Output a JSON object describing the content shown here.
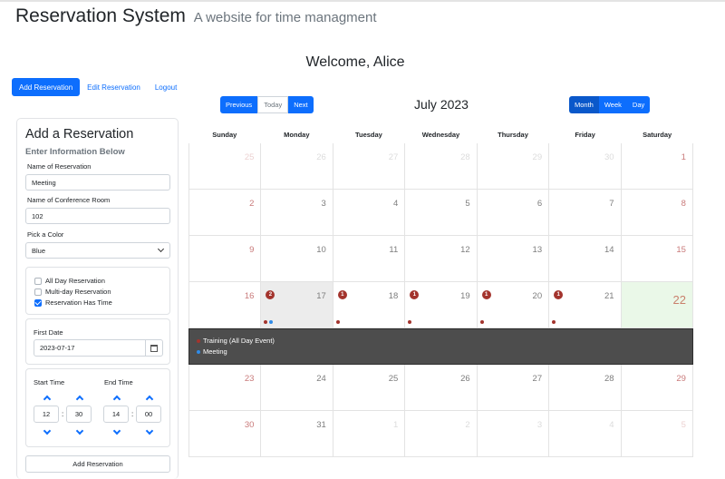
{
  "header": {
    "title": "Reservation System",
    "subtitle": "A website for time managment",
    "welcome": "Welcome, Alice"
  },
  "nav": {
    "add": "Add Reservation",
    "edit": "Edit Reservation",
    "logout": "Logout"
  },
  "form": {
    "title": "Add a Reservation",
    "subtitle": "Enter Information Below",
    "name_label": "Name of Reservation",
    "name_value": "Meeting",
    "room_label": "Name of Conference Room",
    "room_value": "102",
    "color_label": "Pick a Color",
    "color_value": "Blue",
    "options": [
      {
        "label": "All Day Reservation",
        "checked": false
      },
      {
        "label": "Multi-day Reservation",
        "checked": false
      },
      {
        "label": "Reservation Has Time",
        "checked": true
      }
    ],
    "first_date_label": "First Date",
    "first_date_value": "2023-07-17",
    "start_time_label": "Start Time",
    "end_time_label": "End Time",
    "start_hour": "12",
    "start_minute": "30",
    "end_hour": "14",
    "end_minute": "00",
    "submit": "Add Reservation"
  },
  "calendar": {
    "month_title": "July 2023",
    "prev": "Previous",
    "today": "Today",
    "next": "Next",
    "views": [
      "Month",
      "Week",
      "Day"
    ],
    "active_view": "Month",
    "weekdays": [
      "Sunday",
      "Monday",
      "Tuesday",
      "Wednesday",
      "Thursday",
      "Friday",
      "Saturday"
    ],
    "weeks": [
      [
        {
          "d": "25",
          "o": true
        },
        {
          "d": "26",
          "o": true
        },
        {
          "d": "27",
          "o": true
        },
        {
          "d": "28",
          "o": true
        },
        {
          "d": "29",
          "o": true
        },
        {
          "d": "30",
          "o": true
        },
        {
          "d": "1"
        }
      ],
      [
        {
          "d": "2"
        },
        {
          "d": "3"
        },
        {
          "d": "4"
        },
        {
          "d": "5"
        },
        {
          "d": "6"
        },
        {
          "d": "7"
        },
        {
          "d": "8"
        }
      ],
      [
        {
          "d": "9"
        },
        {
          "d": "10"
        },
        {
          "d": "11"
        },
        {
          "d": "12"
        },
        {
          "d": "13"
        },
        {
          "d": "14"
        },
        {
          "d": "15"
        }
      ],
      [
        {
          "d": "16"
        },
        {
          "d": "17",
          "badge": "2",
          "dots": [
            "red",
            "blue"
          ],
          "selected": true
        },
        {
          "d": "18",
          "badge": "1",
          "dots": [
            "red"
          ]
        },
        {
          "d": "19",
          "badge": "1",
          "dots": [
            "red"
          ]
        },
        {
          "d": "20",
          "badge": "1",
          "dots": [
            "red"
          ]
        },
        {
          "d": "21",
          "badge": "1",
          "dots": [
            "red"
          ]
        },
        {
          "d": "22",
          "today": true
        }
      ],
      [
        {
          "d": "23"
        },
        {
          "d": "24"
        },
        {
          "d": "25"
        },
        {
          "d": "26"
        },
        {
          "d": "27"
        },
        {
          "d": "28"
        },
        {
          "d": "29"
        }
      ],
      [
        {
          "d": "30"
        },
        {
          "d": "31"
        },
        {
          "d": "1",
          "o": true
        },
        {
          "d": "2",
          "o": true
        },
        {
          "d": "3",
          "o": true
        },
        {
          "d": "4",
          "o": true
        },
        {
          "d": "5",
          "o": true
        }
      ]
    ],
    "detail_after_week": 3,
    "events": [
      {
        "label": "Training (All Day Event)",
        "color": "#a3342d"
      },
      {
        "label": "Meeting",
        "color": "#2f8be8"
      }
    ],
    "colors": {
      "red": "#a3342d",
      "blue": "#2f8be8"
    }
  }
}
